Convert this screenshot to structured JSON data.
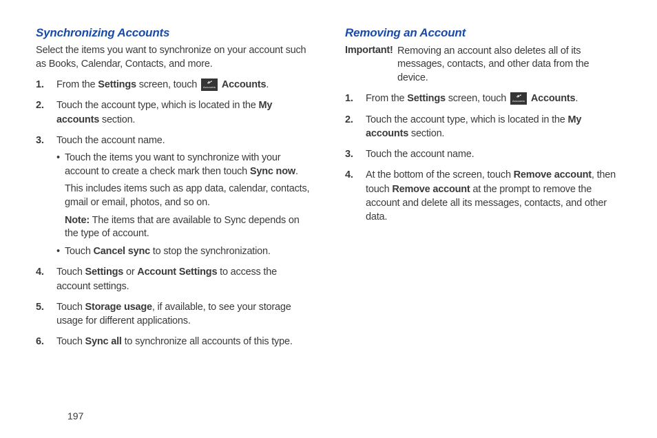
{
  "left": {
    "title": "Synchronizing Accounts",
    "intro": "Select the items you want to synchronize on your account such as Books, Calendar, Contacts, and more.",
    "steps": [
      {
        "num": "1.",
        "pre": "From the ",
        "b1": "Settings",
        "mid": " screen, touch ",
        "icon": true,
        "b2": "Accounts",
        "post": "."
      },
      {
        "num": "2.",
        "pre": "Touch the account type, which is located in the ",
        "b1": "My accounts",
        "post": " section."
      },
      {
        "num": "3.",
        "pre": "Touch the account name.",
        "bullets": [
          {
            "text": "Touch the items you want to synchronize with your account to create a check mark then touch ",
            "b1": "Sync now",
            "post": ".",
            "sub1": "This includes items such as app data, calendar, contacts, gmail or email, photos, and so on.",
            "note_label": "Note:",
            "note_text": " The items that are available to Sync depends on the type of account."
          },
          {
            "text": "Touch ",
            "b1": "Cancel sync",
            "post": " to stop the synchronization."
          }
        ]
      },
      {
        "num": "4.",
        "pre": "Touch ",
        "b1": "Settings",
        "mid": " or ",
        "b2": "Account Settings",
        "post": " to access the account settings."
      },
      {
        "num": "5.",
        "pre": "Touch ",
        "b1": "Storage usage",
        "post": ", if available, to see your storage usage for different applications."
      },
      {
        "num": "6.",
        "pre": "Touch ",
        "b1": "Sync all",
        "post": " to synchronize all accounts of this type."
      }
    ]
  },
  "right": {
    "title": "Removing an Account",
    "important_label": "Important!",
    "important_text": "Removing an account also deletes all of its messages, contacts, and other data from the device.",
    "steps": [
      {
        "num": "1.",
        "pre": "From the ",
        "b1": "Settings",
        "mid": " screen, touch ",
        "icon": true,
        "b2": "Accounts",
        "post": "."
      },
      {
        "num": "2.",
        "pre": "Touch the account type, which is located in the ",
        "b1": "My accounts",
        "post": " section."
      },
      {
        "num": "3.",
        "pre": "Touch the account name."
      },
      {
        "num": "4.",
        "pre": "At the bottom of the screen, touch ",
        "b1": "Remove account",
        "mid": ", then touch ",
        "b2": "Remove account",
        "post": " at the prompt to remove the account and delete all its messages, contacts, and other data."
      }
    ]
  },
  "icon_label": "Accounts",
  "page_num": "197"
}
